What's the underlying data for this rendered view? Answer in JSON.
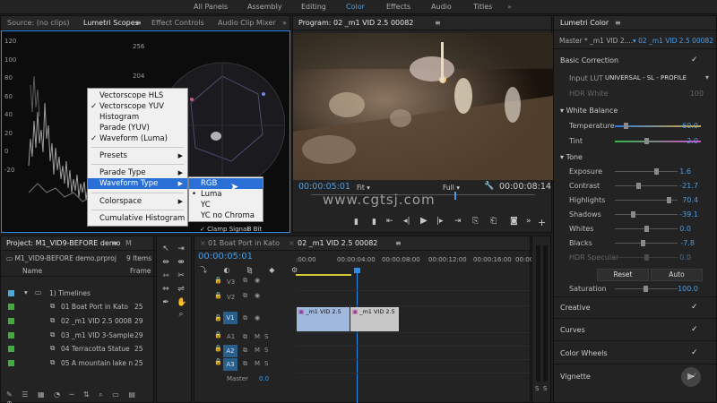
{
  "workspaces": [
    "All Panels",
    "Assembly",
    "Editing",
    "Color",
    "Effects",
    "Audio",
    "Titles"
  ],
  "active_workspace": "Color",
  "scopes_panel": {
    "tabs": [
      "Source: (no clips)",
      "Lumetri Scopes",
      "Effect Controls",
      "Audio Clip Mixer"
    ],
    "left_axis": [
      "120",
      "100",
      "80",
      "60",
      "40",
      "20",
      "0",
      "-20"
    ],
    "right_axis": [
      "256",
      "204",
      "153",
      "102",
      "51",
      "0"
    ],
    "clamp_label": "Clamp Signal",
    "bits": "8 Bit"
  },
  "context_menu": {
    "items": [
      {
        "label": "Vectorscope HLS",
        "checked": false,
        "submenu": false
      },
      {
        "label": "Vectorscope YUV",
        "checked": true,
        "submenu": false
      },
      {
        "label": "Histogram",
        "checked": false,
        "submenu": false
      },
      {
        "label": "Parade (YUV)",
        "checked": false,
        "submenu": false
      },
      {
        "label": "Waveform (Luma)",
        "checked": true,
        "submenu": false
      },
      {
        "label": "Presets",
        "checked": false,
        "submenu": true
      },
      {
        "label": "Parade Type",
        "checked": false,
        "submenu": true
      },
      {
        "label": "Waveform Type",
        "checked": false,
        "submenu": true
      },
      {
        "label": "Colorspace",
        "checked": false,
        "submenu": true
      },
      {
        "label": "Cumulative Histogram",
        "checked": false,
        "submenu": false
      }
    ],
    "submenu_items": [
      "RGB",
      "Luma",
      "YC",
      "YC no Chroma"
    ],
    "submenu_selected": "Luma"
  },
  "program_monitor": {
    "title": "Program: 02 _m1 VID 2.5 00082",
    "timecode": "00:00:05:01",
    "fit": "Fit",
    "quality": "Full",
    "duration": "00:00:08:14",
    "watermark": "www.cgtsj.com"
  },
  "lumetri_color": {
    "title": "Lumetri Color",
    "master_tab": "Master * _m1 VID 2....",
    "clip_tab": "02 _m1 VID 2.5 00082",
    "basic_correction": "Basic Correction",
    "input_lut_label": "Input LUT",
    "input_lut_value": "UNIVERSAL - SL - PROFILE",
    "hdr_white_label": "HDR White",
    "hdr_white_value": "100",
    "white_balance": "White Balance",
    "temperature_label": "Temperature",
    "temperature_value": "-60.0",
    "tint_label": "Tint",
    "tint_value": "-2.0",
    "tone": "Tone",
    "exposure_label": "Exposure",
    "exposure_value": "1.6",
    "contrast_label": "Contrast",
    "contrast_value": "-21.7",
    "highlights_label": "Highlights",
    "highlights_value": "70.4",
    "shadows_label": "Shadows",
    "shadows_value": "-39.1",
    "whites_label": "Whites",
    "whites_value": "0.0",
    "blacks_label": "Blacks",
    "blacks_value": "-7.8",
    "hdr_specular_label": "HDR Specular",
    "hdr_specular_value": "0.0",
    "reset_label": "Reset",
    "auto_label": "Auto",
    "saturation_label": "Saturation",
    "saturation_value": "100.0",
    "sections": [
      "Creative",
      "Curves",
      "Color Wheels",
      "Vignette"
    ]
  },
  "project_panel": {
    "title": "Project: M1_VID9-BEFORE demo",
    "extra_tab": "M",
    "file": "M1_VID9-BEFORE demo.prproj",
    "count": "9 Items",
    "col_name": "Name",
    "col_frame": "Frame",
    "folder": "1) Timelines",
    "items": [
      {
        "name": "01 Boat Port in Kato",
        "frame": "25"
      },
      {
        "name": "02 _m1 VID 2.5 0008",
        "frame": "29"
      },
      {
        "name": "03 _m1 VID 3-Sample",
        "frame": "29"
      },
      {
        "name": "04 Terracotta Statue",
        "frame": "25"
      },
      {
        "name": "05 A mountain lake n",
        "frame": "25"
      }
    ]
  },
  "timeline": {
    "tabs": [
      "01 Boat Port in Kato",
      "02 _m1 VID 2.5 00082"
    ],
    "timecode": "00:00:05:01",
    "ruler": [
      ":00:00",
      "00:00:04:00",
      "00:00:08:00",
      "00:00:12:00",
      "00:00:16:00",
      "00:00"
    ],
    "tracks": [
      "V3",
      "V2",
      "V1",
      "A1",
      "A2",
      "A3",
      "Master"
    ],
    "master_value": "0.0",
    "clip1": "_m1 VID 2.5",
    "clip2": "_m1 VID 2.5",
    "meter_labels": [
      "S",
      "S"
    ]
  }
}
